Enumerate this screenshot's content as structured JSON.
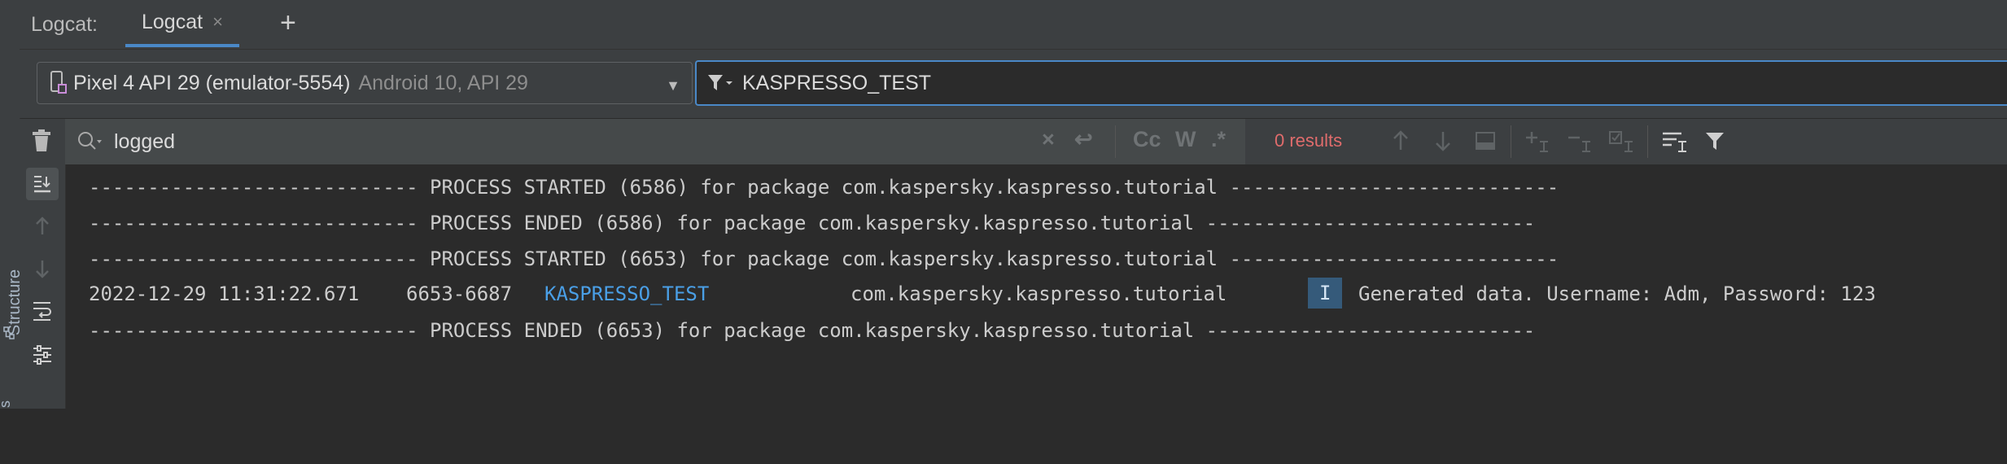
{
  "window": {
    "title": "Logcat:",
    "tab_label": "Logcat",
    "tab_close": "×",
    "add_tab": "+"
  },
  "sidebar": {
    "structure_label": "Structure",
    "partial_label": "s"
  },
  "device": {
    "name": "Pixel 4 API 29 (emulator-5554)",
    "details": "Android 10, API 29"
  },
  "filter": {
    "value": "KASPRESSO_TEST"
  },
  "search": {
    "value": "logged",
    "results": "0 results",
    "clear": "×",
    "wrap": "↩",
    "case": "Cc",
    "word": "W",
    "regex": ".*"
  },
  "log": {
    "lines": [
      "---------------------------- PROCESS STARTED (6586) for package com.kaspersky.kaspresso.tutorial ----------------------------",
      "---------------------------- PROCESS ENDED (6586) for package com.kaspersky.kaspresso.tutorial ----------------------------",
      "---------------------------- PROCESS STARTED (6653) for package com.kaspersky.kaspresso.tutorial ----------------------------",
      "---------------------------- PROCESS ENDED (6653) for package com.kaspersky.kaspresso.tutorial ----------------------------"
    ],
    "entry": {
      "timestamp": "2022-12-29 11:31:22.671",
      "pid_tid": "6653-6687",
      "tag": "KASPRESSO_TEST",
      "package": "com.kaspersky.kaspresso.tutorial",
      "level": "I",
      "message": "Generated data. Username: Adm, Password: 123"
    }
  },
  "colors": {
    "accent": "#4a88c7",
    "tag": "#4a9fe6",
    "results": "#e06c6c",
    "level_badge": "#355a7a"
  }
}
